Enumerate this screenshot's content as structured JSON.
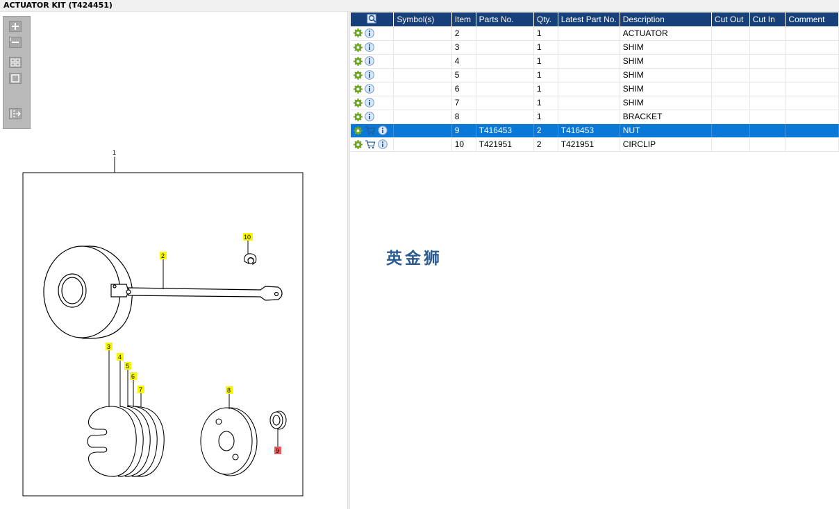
{
  "window": {
    "title": "ACTUATOR KIT (T424451)"
  },
  "toolbox": {
    "buttons": [
      {
        "name": "zoom-in-icon"
      },
      {
        "name": "zoom-out-icon"
      },
      {
        "name": "fit-all-icon"
      },
      {
        "name": "fit-page-icon"
      },
      {
        "name": "export-icon"
      }
    ]
  },
  "diagram": {
    "callouts": {
      "c1": "1",
      "c2": "2",
      "c3": "3",
      "c4": "4",
      "c5": "5",
      "c6": "6",
      "c7": "7",
      "c8": "8",
      "c9": "9",
      "c10": "10"
    },
    "highlight_color": "#f7f700",
    "selected_highlight_color": "#f05a5a"
  },
  "table": {
    "header_color": "#17407a",
    "selected_color": "#0a78d7",
    "columns": {
      "filter": "",
      "symbols": "Symbol(s)",
      "item": "Item",
      "parts_no": "Parts No.",
      "qty": "Qty.",
      "latest_part_no": "Latest Part No.",
      "description": "Description",
      "cut_out": "Cut Out",
      "cut_in": "Cut In",
      "comment": "Comment"
    },
    "rows": [
      {
        "item": "2",
        "parts_no": "",
        "qty": "1",
        "latest": "",
        "description": "ACTUATOR",
        "cut_out": "",
        "cut_in": "",
        "comment": "",
        "cart": false,
        "selected": false
      },
      {
        "item": "3",
        "parts_no": "",
        "qty": "1",
        "latest": "",
        "description": "SHIM",
        "cut_out": "",
        "cut_in": "",
        "comment": "",
        "cart": false,
        "selected": false
      },
      {
        "item": "4",
        "parts_no": "",
        "qty": "1",
        "latest": "",
        "description": "SHIM",
        "cut_out": "",
        "cut_in": "",
        "comment": "",
        "cart": false,
        "selected": false
      },
      {
        "item": "5",
        "parts_no": "",
        "qty": "1",
        "latest": "",
        "description": "SHIM",
        "cut_out": "",
        "cut_in": "",
        "comment": "",
        "cart": false,
        "selected": false
      },
      {
        "item": "6",
        "parts_no": "",
        "qty": "1",
        "latest": "",
        "description": "SHIM",
        "cut_out": "",
        "cut_in": "",
        "comment": "",
        "cart": false,
        "selected": false
      },
      {
        "item": "7",
        "parts_no": "",
        "qty": "1",
        "latest": "",
        "description": "SHIM",
        "cut_out": "",
        "cut_in": "",
        "comment": "",
        "cart": false,
        "selected": false
      },
      {
        "item": "8",
        "parts_no": "",
        "qty": "1",
        "latest": "",
        "description": "BRACKET",
        "cut_out": "",
        "cut_in": "",
        "comment": "",
        "cart": false,
        "selected": false
      },
      {
        "item": "9",
        "parts_no": "T416453",
        "qty": "2",
        "latest": "T416453",
        "description": "NUT",
        "cut_out": "",
        "cut_in": "",
        "comment": "",
        "cart": true,
        "selected": true
      },
      {
        "item": "10",
        "parts_no": "T421951",
        "qty": "2",
        "latest": "T421951",
        "description": "CIRCLIP",
        "cut_out": "",
        "cut_in": "",
        "comment": "",
        "cart": true,
        "selected": false
      }
    ]
  },
  "watermark": "英金狮"
}
